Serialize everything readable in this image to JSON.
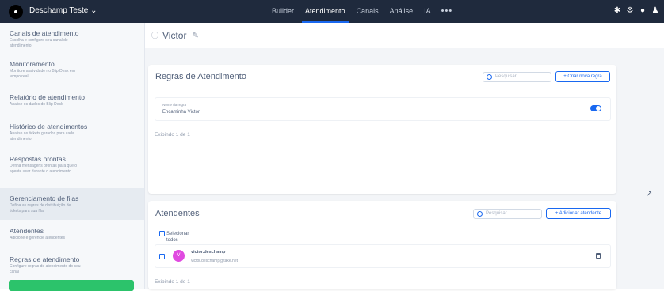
{
  "topbar": {
    "bot_name": "Deschamp Teste ⌄",
    "nav": [
      {
        "label": "Builder"
      },
      {
        "label": "Atendimento"
      },
      {
        "label": "Canais"
      },
      {
        "label": "Análise"
      },
      {
        "label": "IA"
      }
    ],
    "more": "•••"
  },
  "sidebar": {
    "items": [
      {
        "title": "Canais de atendimento",
        "desc": "Escolha e configure seu canal de atendimento"
      },
      {
        "title": "Monitoramento",
        "desc": "Monitore a atividade no Blip Desk em tempo real"
      },
      {
        "title": "Relatório de atendimento",
        "desc": "Analise os dados do Blip Desk"
      },
      {
        "title": "Histórico de atendimentos",
        "desc": "Analise os tickets gerados para cada atendimento"
      },
      {
        "title": "Respostas prontas",
        "desc": "Defina mensagens prontas para que o agente usar durante o atendimento"
      },
      {
        "title": "Gerenciamento de filas",
        "desc": "Defina as regras de distribuição de tickets para sua fila"
      },
      {
        "title": "Atendentes",
        "desc": "Adicione e gerencie atendentes"
      },
      {
        "title": "Regras de atendimento",
        "desc": "Configure regras de atendimento do seu canal"
      }
    ]
  },
  "page": {
    "title": "Victor"
  },
  "rules_card": {
    "title": "Regras de Atendimento",
    "search_placeholder": "Pesquisar",
    "create_button": "+ Criar nova regra",
    "rule_label": "Nome da regra",
    "rule_name": "Encaminha Victor",
    "rule_enabled": true,
    "showing": "Exibindo 1 de 1"
  },
  "agents_card": {
    "title": "Atendentes",
    "search_placeholder": "Pesquisar",
    "add_button": "+ Adicionar atendente",
    "select_all": "Selecionar todos",
    "agents": [
      {
        "initial": "V",
        "name": "victor.deschamp",
        "email": "victor.deschamp@take.net"
      }
    ],
    "showing": "Exibindo 1 de 1"
  },
  "colors": {
    "topbar": "#1f2a3d",
    "accent": "#1968f0",
    "avatar": "#e04ae0",
    "sidebar_button": "#2cc36b"
  }
}
